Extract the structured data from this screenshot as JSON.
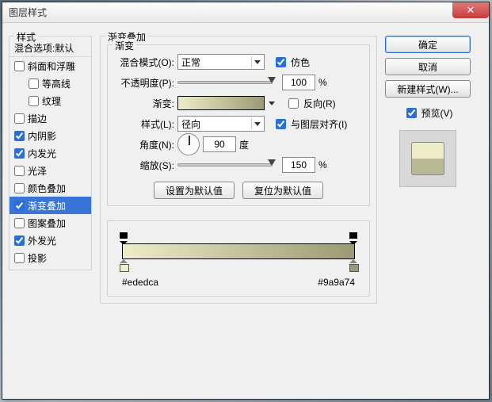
{
  "window": {
    "title": "图层样式"
  },
  "left": {
    "header": "样式",
    "blend_defaults": "混合选项:默认",
    "items": [
      {
        "label": "斜面和浮雕",
        "checked": false,
        "selected": false,
        "sub": false
      },
      {
        "label": "等高线",
        "checked": false,
        "selected": false,
        "sub": true
      },
      {
        "label": "纹理",
        "checked": false,
        "selected": false,
        "sub": true
      },
      {
        "label": "描边",
        "checked": false,
        "selected": false,
        "sub": false
      },
      {
        "label": "内阴影",
        "checked": true,
        "selected": false,
        "sub": false
      },
      {
        "label": "内发光",
        "checked": true,
        "selected": false,
        "sub": false
      },
      {
        "label": "光泽",
        "checked": false,
        "selected": false,
        "sub": false
      },
      {
        "label": "颜色叠加",
        "checked": false,
        "selected": false,
        "sub": false
      },
      {
        "label": "渐变叠加",
        "checked": true,
        "selected": true,
        "sub": false
      },
      {
        "label": "图案叠加",
        "checked": false,
        "selected": false,
        "sub": false
      },
      {
        "label": "外发光",
        "checked": true,
        "selected": false,
        "sub": false
      },
      {
        "label": "投影",
        "checked": false,
        "selected": false,
        "sub": false
      }
    ]
  },
  "mid": {
    "outer_legend": "渐变叠加",
    "inner_legend": "渐变",
    "blend_mode_label": "混合模式(O):",
    "blend_mode_value": "正常",
    "dither_label": "仿色",
    "dither_checked": true,
    "opacity_label": "不透明度(P):",
    "opacity_value": "100",
    "percent": "%",
    "gradient_label": "渐变:",
    "reverse_label": "反向(R)",
    "reverse_checked": false,
    "style_label": "样式(L):",
    "style_value": "径向",
    "align_label": "与图层对齐(I)",
    "align_checked": true,
    "angle_label": "角度(N):",
    "angle_value": "90",
    "angle_unit": "度",
    "scale_label": "缩放(S):",
    "scale_value": "150",
    "reset_default": "设置为默认值",
    "restore_default": "复位为默认值",
    "hex_left": "#ededca",
    "hex_right": "#9a9a74"
  },
  "right": {
    "ok": "确定",
    "cancel": "取消",
    "new_style": "新建样式(W)...",
    "preview_label": "预览(V)",
    "preview_checked": true
  }
}
